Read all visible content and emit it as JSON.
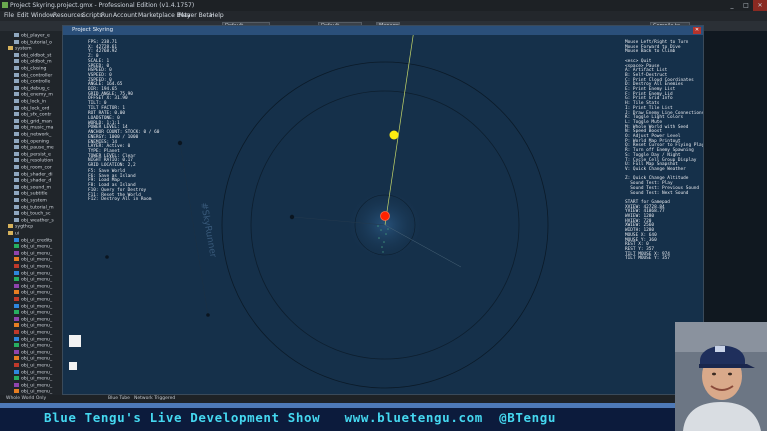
{
  "titlebar": {
    "title": "Project Skyring.project.gmx  -  Professional Edition (v1.4.1757)",
    "minimize": "_",
    "maximize": "□",
    "close": "✕"
  },
  "menu": [
    "File",
    "Edit",
    "Window",
    "Resources",
    "Scripts",
    "Run",
    "Account",
    "Marketplace Beta",
    "Player Beta",
    "Help"
  ],
  "toolbar": {
    "target_field": "Default",
    "config_field": "Default",
    "manage_button": "Manage",
    "cmd_field": "Compile to Zone"
  },
  "tree": {
    "items": [
      {
        "label": "obj_player_e",
        "kind": "obj"
      },
      {
        "label": "obj_tutorial_o",
        "kind": "obj"
      },
      {
        "label": "system",
        "kind": "folder"
      },
      {
        "label": "obj_oldbot_st",
        "kind": "obj"
      },
      {
        "label": "obj_oldbot_m",
        "kind": "obj"
      },
      {
        "label": "obj_closing",
        "kind": "obj"
      },
      {
        "label": "obj_controller",
        "kind": "obj"
      },
      {
        "label": "obj_controlle",
        "kind": "obj"
      },
      {
        "label": "obj_debug_c",
        "kind": "obj"
      },
      {
        "label": "obj_enemy_m",
        "kind": "obj"
      },
      {
        "label": "obj_lock_in",
        "kind": "obj"
      },
      {
        "label": "obj_lock_ord",
        "kind": "obj"
      },
      {
        "label": "obj_sfx_contr",
        "kind": "obj"
      },
      {
        "label": "obj_grid_man",
        "kind": "obj"
      },
      {
        "label": "obj_music_ma",
        "kind": "obj"
      },
      {
        "label": "obj_network_",
        "kind": "obj"
      },
      {
        "label": "obj_opening",
        "kind": "obj"
      },
      {
        "label": "obj_pause_me",
        "kind": "obj"
      },
      {
        "label": "obj_persist_e",
        "kind": "obj"
      },
      {
        "label": "obj_resolution",
        "kind": "obj"
      },
      {
        "label": "obj_room_cor",
        "kind": "obj"
      },
      {
        "label": "obj_shader_di",
        "kind": "obj"
      },
      {
        "label": "obj_shader_d",
        "kind": "obj"
      },
      {
        "label": "obj_sound_m",
        "kind": "obj"
      },
      {
        "label": "obj_subtitle",
        "kind": "obj"
      },
      {
        "label": "obj_system",
        "kind": "obj"
      },
      {
        "label": "obj_tutorial_m",
        "kind": "obj"
      },
      {
        "label": "obj_touch_sc",
        "kind": "obj"
      },
      {
        "label": "obj_weather_s",
        "kind": "obj"
      },
      {
        "label": "sygthcp",
        "kind": "folder"
      },
      {
        "label": "ui",
        "kind": "folder"
      },
      {
        "label": "obj_ui_credits",
        "kind": "obj"
      },
      {
        "label": "obj_ui_menu_",
        "kind": "obj"
      },
      {
        "label": "obj_ui_menu_",
        "kind": "obj"
      },
      {
        "label": "obj_ui_menu_",
        "kind": "obj"
      },
      {
        "label": "obj_ui_menu_",
        "kind": "obj"
      },
      {
        "label": "obj_ui_menu_",
        "kind": "obj"
      },
      {
        "label": "obj_ui_menu_",
        "kind": "obj"
      },
      {
        "label": "obj_ui_menu_",
        "kind": "obj"
      },
      {
        "label": "obj_ui_menu_",
        "kind": "obj"
      },
      {
        "label": "obj_ui_menu_",
        "kind": "obj"
      },
      {
        "label": "obj_ui_menu_",
        "kind": "obj"
      },
      {
        "label": "obj_ui_menu_",
        "kind": "obj"
      },
      {
        "label": "obj_ui_menu_",
        "kind": "obj"
      },
      {
        "label": "obj_ui_menu_",
        "kind": "obj"
      },
      {
        "label": "obj_ui_menu_",
        "kind": "obj"
      },
      {
        "label": "obj_ui_menu_",
        "kind": "obj"
      },
      {
        "label": "obj_ui_menu_",
        "kind": "obj"
      },
      {
        "label": "obj_ui_menu_",
        "kind": "obj"
      },
      {
        "label": "obj_ui_menu_",
        "kind": "obj"
      },
      {
        "label": "obj_ui_menu_",
        "kind": "obj"
      },
      {
        "label": "obj_ui_menu_",
        "kind": "obj"
      },
      {
        "label": "obj_ui_menu_",
        "kind": "obj"
      },
      {
        "label": "obj_ui_menu_",
        "kind": "obj"
      },
      {
        "label": "obj_ui_menu_",
        "kind": "obj"
      }
    ]
  },
  "game_window": {
    "title": "Project Skyring",
    "close": "✕"
  },
  "hud_left_stats": "FPS: 238.71\nX: 42728.61\nY: 42768.92\nZ: 0\nSCALE: 1\nSPEED: 0\nHSPEED: 0\nVSPEED: 0\nZSPEED: 0\nANGLE: 164.65\nDIR: 194.65\nGRID ANGLE: 75.90\nOFFSET X: 31.90\nTILT: 0\nTILT FACTOR: 1\nROT RATE: 0.00",
  "hud_left_world": "LOADSTONE: 0\nWORLD: 1:1:1\nPOWER LEVEL: 14\nANCHOR COUNT: STOCK: 0 / 60\nENERGY: 1000 / 1000\nENEMIES: 14\nLAYER: Active: 0\nTYPE: Planet\nTOWER LEVEL: Clear\nNIGHT RATIO: 0.17\nGRID LOCATION: 2,2",
  "hud_left_keys": "F5: Save World\nF6: Save as Island\nF9: Load Map\nF8: Load as Island\nF10: Query for Destroy\nF11: Reset the World\nF12: Destroy All in Room",
  "hud_right_help": "Mouse Left/Right to Turn\nMouse Forward to Dive\nMouse Back to Climb\n\n<esc> Quit\n<space> Pause\nA: Artifact List\nB: Self-Destruct\nC: Print Cloud Coordinates\nD: Destroy All Enemies\nE: Print Enemy List\nF: Print Enemy Lid\nG: Print Grid Info\nH: Tile Stats\nI: Print Tile List\nJ: Draw Enemy Line Connections\nK: Toggle Light Colors\nL: Toggle Mute\nM: Whole World with Seed\nN: Speed Boost\nO: Adjust Power Level\nP: World Map Printout\nQ: Reset Cursor to Flying Player\nR: Turn off Enemy Spawning\nS: Toggle Day / Night\nT: Cycle Cell Group Display\nU: Full Map Snapshot\nV: Quick Change Weather\n\nZ: Quick Change Altitude\n  Sound Test: Play\n  Sound Test: Previous Sound\n  Sound Test: Next Sound\n\nSTART for Gamepad\nXVIEW: 42728.84\nYVIEW: 41868.77\nWVIEW: 1280\nHVIEW: 720\nXWIEW: 2560\nWIDTH: 1280\nMOUSE X: 640\nMOUSE Y: 360\nREST X: 0\nREST Y: 357\nTILT MOUSE X: 974\nTILT MOUSE Y: 357",
  "statusbar": {
    "left": "Whole World Only",
    "center": "Blue Tube",
    "right": "Network Triggered"
  },
  "banner": {
    "text": "Blue Tengu's Live Development Show   www.bluetengu.com  @BTengu"
  },
  "colors": {
    "player": "#ff2200",
    "sun": "#ffee11",
    "banner_text": "#45d8f0",
    "water": "#15304a"
  }
}
